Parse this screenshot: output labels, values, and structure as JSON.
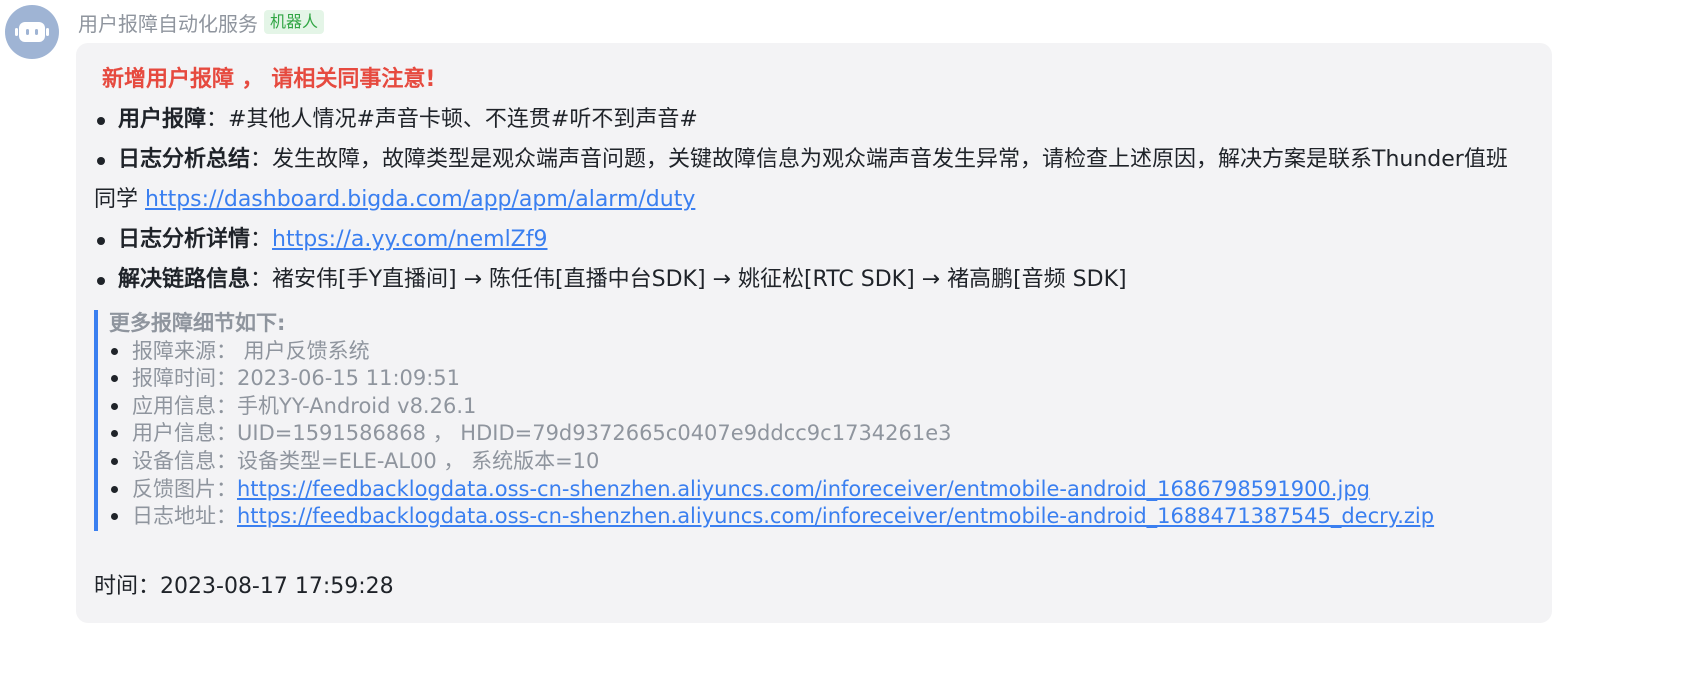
{
  "sender": {
    "name": "用户报障自动化服务",
    "tag": "机器人"
  },
  "message": {
    "headline": "新增用户报障 ， 请相关同事注意!",
    "items": [
      {
        "label": "用户报障",
        "sep": "：",
        "text": "#其他人情况#声音卡顿、不连贯#听不到声音#",
        "link": ""
      },
      {
        "label": "日志分析总结",
        "sep": "：",
        "text": "发生故障，故障类型是观众端声音问题，关键故障信息为观众端声音发生异常，请检查上述原因，解决方案是联系Thunder值班同学 ",
        "link": "https://dashboard.bigda.com/app/apm/alarm/duty"
      },
      {
        "label": "日志分析详情",
        "sep": "：",
        "text": "",
        "link": "https://a.yy.com/nemlZf9"
      },
      {
        "label": "解决链路信息",
        "sep": "：",
        "text": "褚安伟[手Y直播间] → 陈任伟[直播中台SDK] → 姚征松[RTC SDK] → 褚高鹏[音频 SDK]",
        "link": ""
      }
    ],
    "details": {
      "title": "更多报障细节如下:",
      "items": [
        {
          "label": "报障来源：",
          "value": " 用户反馈系统",
          "link": ""
        },
        {
          "label": "报障时间：",
          "value": "2023-06-15 11:09:51",
          "link": ""
        },
        {
          "label": "应用信息：",
          "value": "手机YY-Android v8.26.1",
          "link": ""
        },
        {
          "label": "用户信息：",
          "value": "UID=1591586868 ， HDID=79d9372665c0407e9ddcc9c1734261e3",
          "link": ""
        },
        {
          "label": "设备信息：",
          "value": "设备类型=ELE-AL00 ， 系统版本=10",
          "link": ""
        },
        {
          "label": "反馈图片：",
          "value": "",
          "link": "https://feedbacklogdata.oss-cn-shenzhen.aliyuncs.com/inforeceiver/entmobile-android_1686798591900.jpg"
        },
        {
          "label": "日志地址：",
          "value": "",
          "link": "https://feedbacklogdata.oss-cn-shenzhen.aliyuncs.com/inforeceiver/entmobile-android_1688471387545_decry.zip"
        }
      ]
    },
    "time_label": "时间：",
    "time_value": "2023-08-17 17:59:28"
  },
  "colors": {
    "headline": "#e64a3f",
    "link": "#3a7ff0",
    "muted": "#8f959e",
    "bubble_bg": "#f3f3f5",
    "avatar_bg": "#9fb4d4",
    "tag_bg": "#e4f5e7",
    "tag_text": "#32a645"
  },
  "icons": {
    "avatar": "robot-icon"
  }
}
